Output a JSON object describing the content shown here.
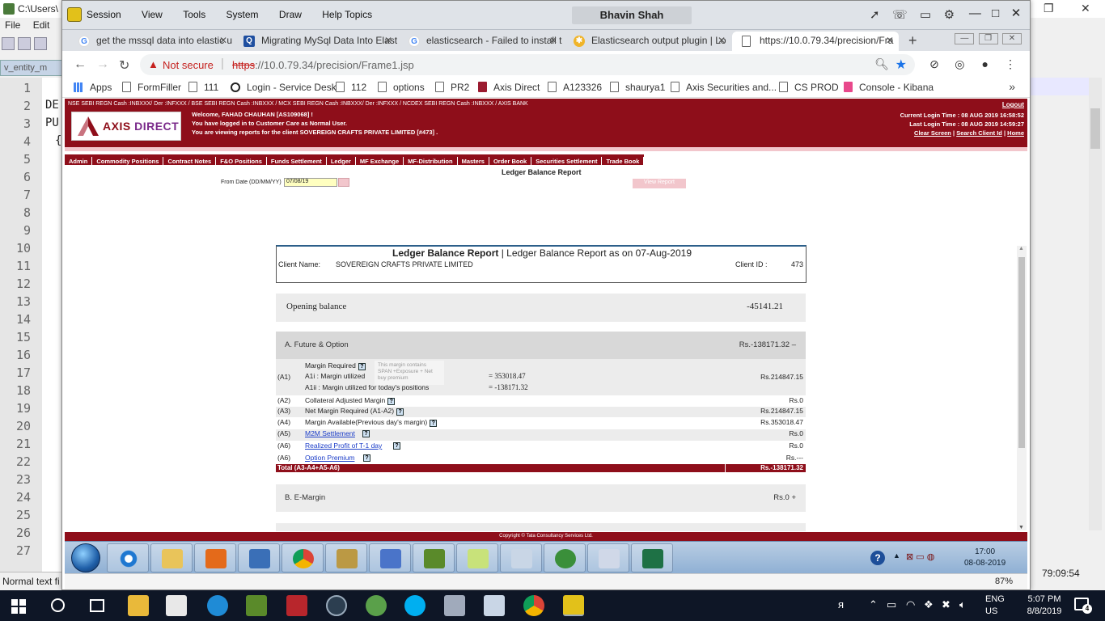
{
  "bg_editor": {
    "title": "C:\\Users\\",
    "menu": [
      "File",
      "Edit"
    ],
    "tab": "v_entity_m",
    "line_numbers": [
      "1",
      "2",
      "3",
      "4",
      "5",
      "6",
      "7",
      "8",
      "9",
      "10",
      "11",
      "12",
      "13",
      "14",
      "15",
      "16",
      "17",
      "18",
      "19",
      "20",
      "21",
      "22",
      "23",
      "24",
      "25",
      "26",
      "27"
    ],
    "code_fragments": [
      "DE",
      "PU",
      "{"
    ],
    "status_left": "Normal text fi",
    "clock": "79:09:54"
  },
  "session_window": {
    "menu": [
      "Session",
      "View",
      "Tools",
      "System",
      "Draw",
      "Help Topics"
    ],
    "user": "Bhavin Shah",
    "zoom": "87%"
  },
  "browser": {
    "tabs": [
      {
        "label": "get the mssql data into elastic u",
        "icon": "google-icon"
      },
      {
        "label": "Migrating MySql Data Into Elast",
        "icon": "migrating-icon"
      },
      {
        "label": "elasticsearch - Failed to install t",
        "icon": "google-icon"
      },
      {
        "label": "Elasticsearch output plugin | Lo",
        "icon": "elastic-icon"
      },
      {
        "label": "https://10.0.79.34/precision/Fra",
        "icon": "page-icon"
      }
    ],
    "address": {
      "security": "Not secure",
      "scheme": "https",
      "rest": "://10.0.79.34/precision/Frame1.jsp"
    },
    "bookmarks": [
      "Apps",
      "FormFiller",
      "111",
      "Login - Service Desk",
      "112",
      "options",
      "PR2",
      "Axis Direct",
      "A123326",
      "shaurya1",
      "Axis Securities and...",
      "CS PROD",
      "Console - Kibana"
    ]
  },
  "axis": {
    "regn": "NSE SEBI REGN Cash :INBXXX/ Der :INFXXX  / BSE SEBI REGN Cash :INBXXX /  MCX SEBI REGN Cash :INBXXX/ Der :INFXXX / NCDEX SEBI REGN Cash :INBXXX / AXIS BANK",
    "brand_1": "AXIS",
    "brand_2": "DIRECT",
    "welcome_1": "Welcome, FAHAD CHAUHAN [AS109068] !",
    "welcome_2": "You have logged in to Customer Care as Normal User.",
    "welcome_3": "You are viewing reports for the client SOVEREIGN CRAFTS PRIVATE LIMITED [#473] .",
    "logout": "Logout",
    "current_login": "Current Login Time : 08 AUG 2019 16:58:52",
    "last_login": "Last Login Time : 08 AUG 2019 14:59:27",
    "clear_screen": "Clear Screen",
    "search_client": "Search Client Id",
    "home": "Home",
    "nav": [
      "Admin",
      "Commodity Positions",
      "Contract Notes",
      "F&O Positions",
      "Funds Settlement",
      "Ledger",
      "MF Exchange",
      "MF-Distribution",
      "Masters",
      "Order Book",
      "Securities Settlement",
      "Trade Book"
    ],
    "page_title": "Ledger Balance Report",
    "from_date_label": "From Date (DD/MM/YY)",
    "from_date_value": "07/08/19",
    "view_report": "View Report",
    "copyright": "Copyright © Tata Consultancy Services Ltd."
  },
  "report": {
    "title_bold": "Ledger Balance Report",
    "title_rest": " | Ledger Balance Report as on 07-Aug-2019",
    "client_name_label": "Client Name:",
    "client_name": "SOVEREIGN CRAFTS PRIVATE LIMITED",
    "client_id_label": "Client ID  :",
    "client_id": "473",
    "opening_label": "Opening balance",
    "opening_value": "-45141.21",
    "section_a_label": "A. Future & Option",
    "section_a_value": "Rs.-138171.32  –",
    "a1": {
      "code": "(A1)",
      "l1": "Margin Required",
      "l2": "A1i :   Margin utilized",
      "l3": "A1ii :   Margin utilized for today's positions",
      "v2": "=  353018.47",
      "v3": "=  -138171.32",
      "amount": "Rs.214847.15",
      "tooltip": "This margin contains SPAN +Exposure + Net buy premium"
    },
    "rows": [
      {
        "code": "(A2)",
        "label": "Collateral Adjusted Margin",
        "amount": "Rs.0",
        "link": false
      },
      {
        "code": "(A3)",
        "label": "Net Margin Required (A1-A2)",
        "amount": "Rs.214847.15",
        "link": false
      },
      {
        "code": "(A4)",
        "label": "Margin Available(Previous day's margin)",
        "amount": "Rs.353018.47",
        "link": false
      },
      {
        "code": "(A5)",
        "label": "M2M Settlement",
        "amount": "Rs.0",
        "link": true
      },
      {
        "code": "(A6)",
        "label": "Realized Profit of T-1 day",
        "amount": "Rs.0",
        "link": true
      },
      {
        "code": "(A6)",
        "label": "Option Premium",
        "amount": "Rs.---",
        "link": true
      }
    ],
    "total_label": "Total (A3-A4+A5-A6)",
    "total_value": "Rs.-138171.32",
    "section_b_label": "B. E-Margin",
    "section_b_value": "Rs.0  +"
  },
  "inner_taskbar": {
    "time": "17:00",
    "date": "08-08-2019"
  },
  "host_taskbar": {
    "lang_1": "ENG",
    "lang_2": "US",
    "time": "5:07 PM",
    "date": "8/8/2019",
    "notifications": "4"
  },
  "colors": {
    "axis_maroon": "#8e0e1a",
    "axis_pink": "#f2c6cc",
    "link_blue": "#1a3cc8",
    "chrome_star": "#1a73e8"
  }
}
